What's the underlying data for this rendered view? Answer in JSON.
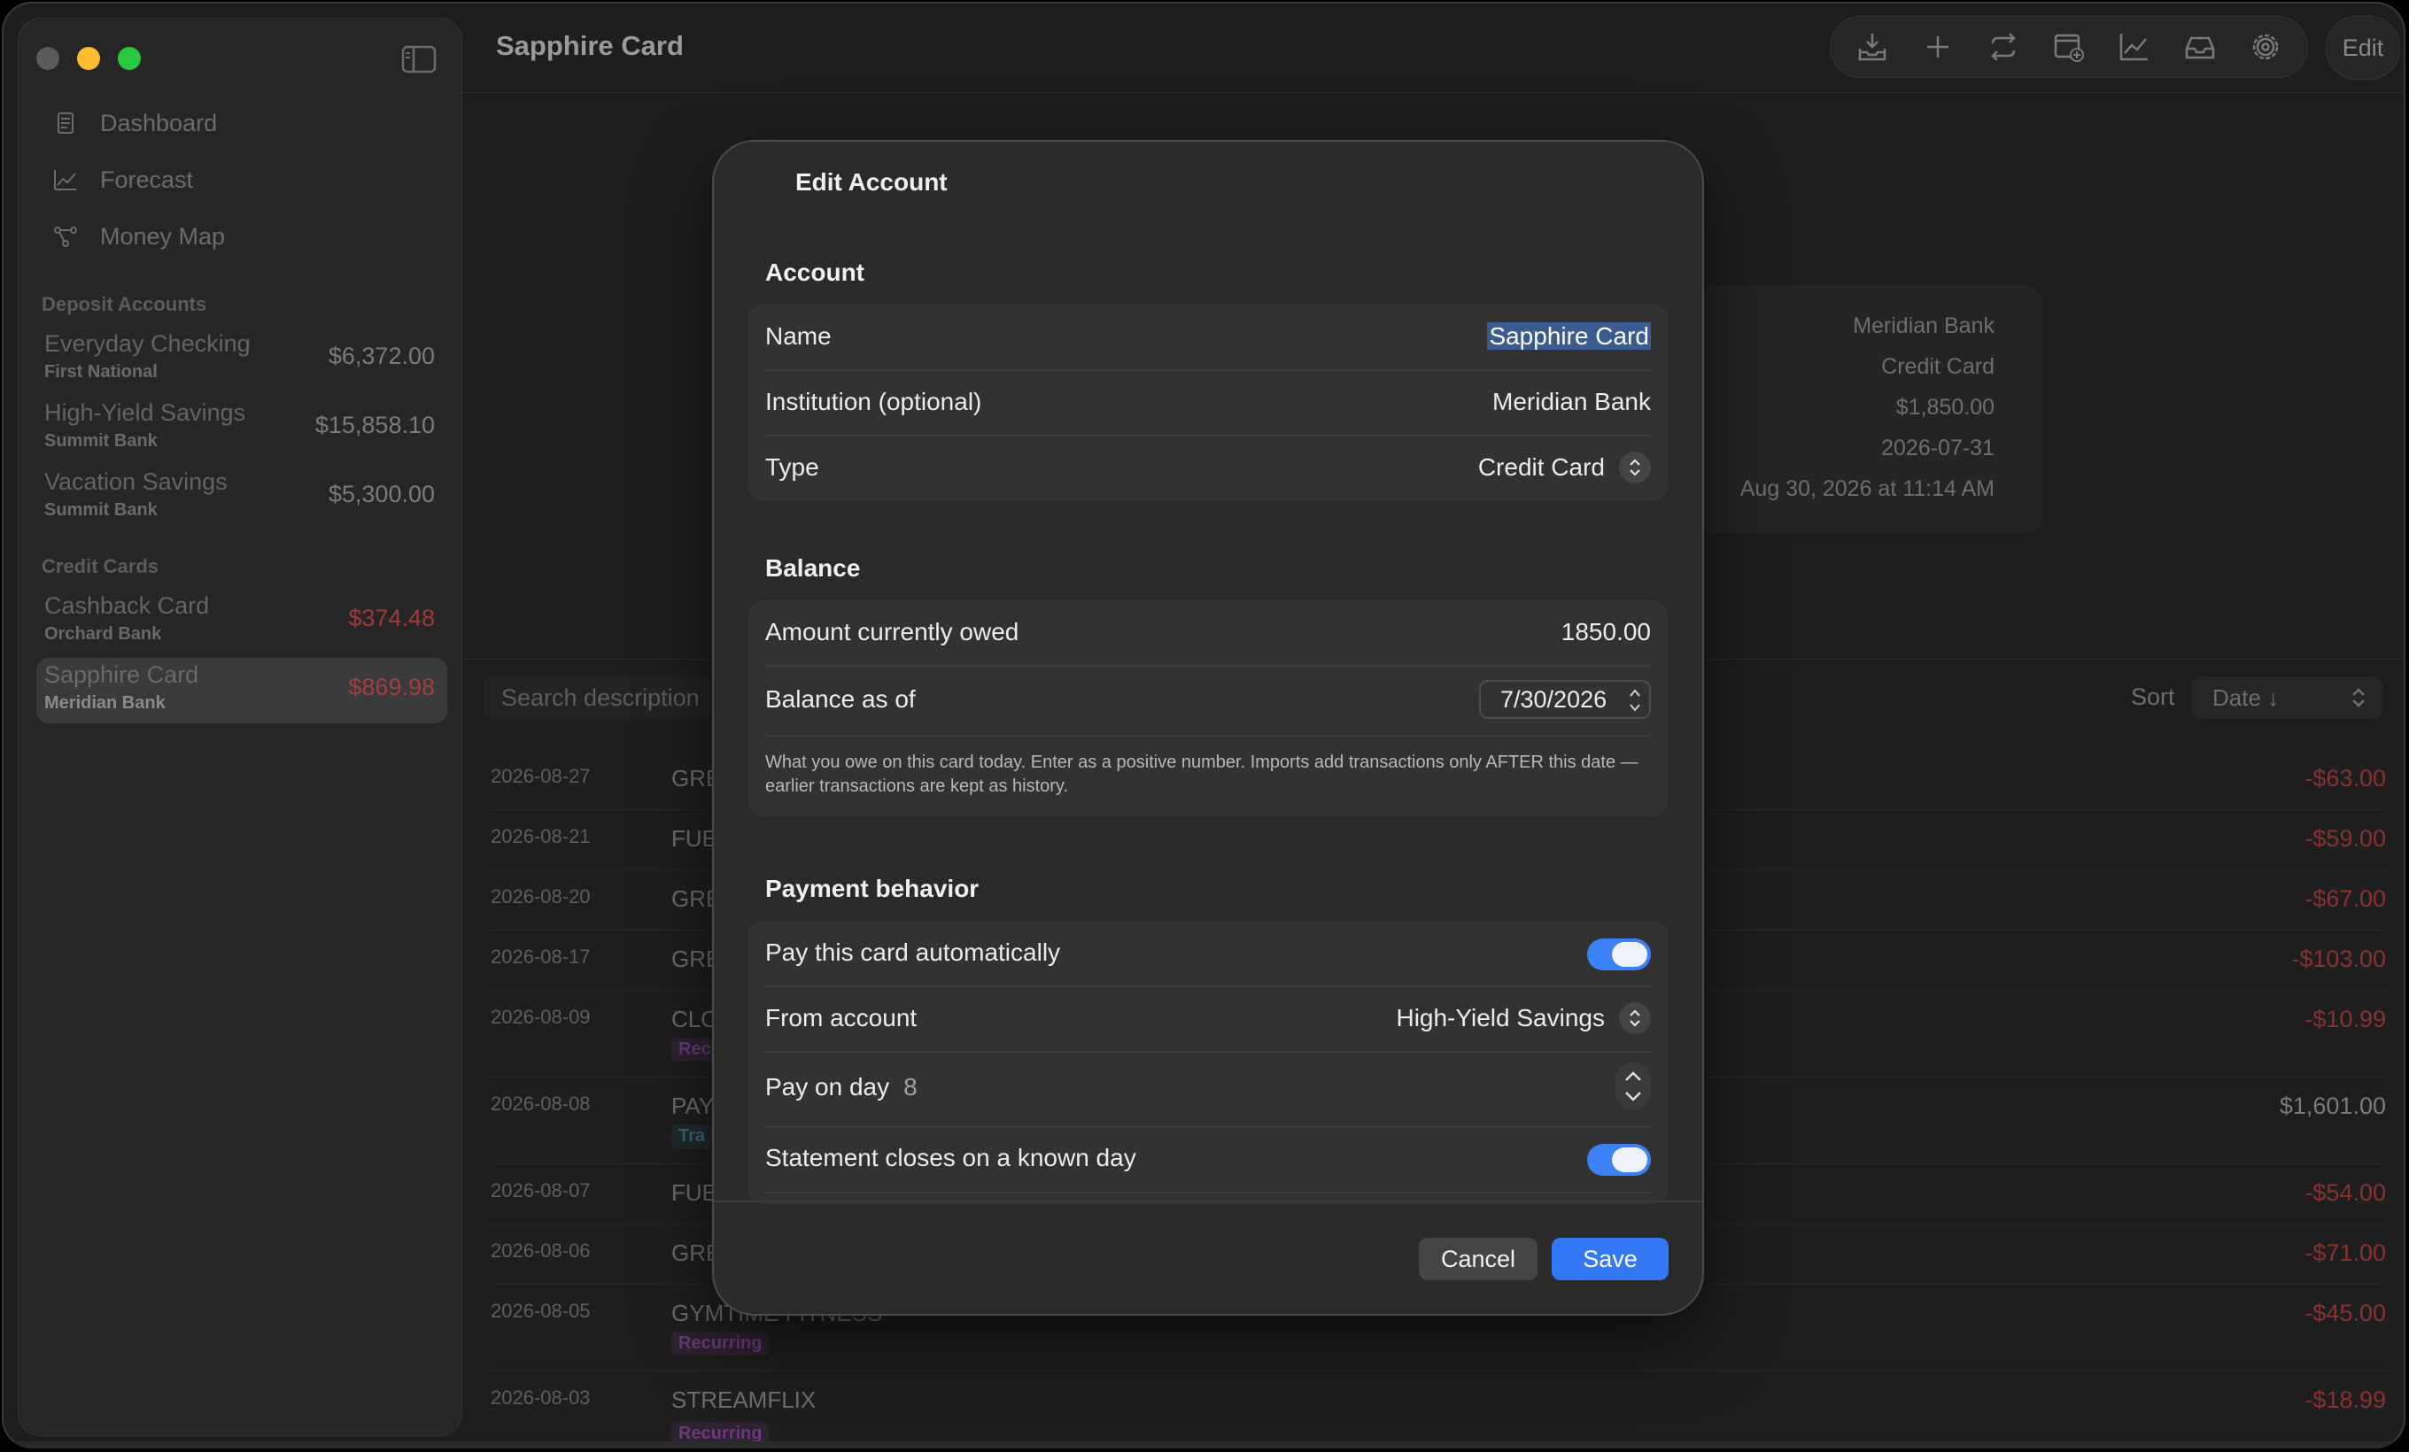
{
  "window": {
    "title": "Sapphire Card"
  },
  "sidebar": {
    "nav": [
      {
        "label": "Dashboard",
        "icon": "document-icon"
      },
      {
        "label": "Forecast",
        "icon": "chart-line-icon"
      },
      {
        "label": "Money Map",
        "icon": "graph-nodes-icon"
      }
    ],
    "deposit_label": "Deposit Accounts",
    "deposit_accounts": [
      {
        "name": "Everyday Checking",
        "institution": "First National",
        "balance": "$6,372.00"
      },
      {
        "name": "High-Yield Savings",
        "institution": "Summit Bank",
        "balance": "$15,858.10"
      },
      {
        "name": "Vacation Savings",
        "institution": "Summit Bank",
        "balance": "$5,300.00"
      }
    ],
    "credit_label": "Credit Cards",
    "credit_accounts": [
      {
        "name": "Cashback Card",
        "institution": "Orchard Bank",
        "balance": "$374.48"
      },
      {
        "name": "Sapphire Card",
        "institution": "Meridian Bank",
        "balance": "$869.98"
      }
    ]
  },
  "toolbar": {
    "icons": [
      "import-tray-icon",
      "plus-icon",
      "transfer-icon",
      "calendar-add-icon",
      "chart-icon",
      "inbox-icon",
      "gear-icon"
    ],
    "edit_label": "Edit"
  },
  "details": [
    "Meridian Bank",
    "Credit Card",
    "$1,850.00",
    "2026-07-31",
    "Aug 30, 2026 at 11:14 AM"
  ],
  "list": {
    "search_placeholder": "Search description",
    "sort_label": "Sort",
    "sort_value": "Date ↓",
    "transactions": [
      {
        "date": "2026-08-27",
        "desc": "GRE",
        "amount": "-$63.00"
      },
      {
        "date": "2026-08-21",
        "desc": "FUE",
        "amount": "-$59.00"
      },
      {
        "date": "2026-08-20",
        "desc": "GRE",
        "amount": "-$67.00"
      },
      {
        "date": "2026-08-17",
        "desc": "GRE",
        "amount": "-$103.00"
      },
      {
        "date": "2026-08-09",
        "desc": "CLO",
        "amount": "-$10.99",
        "tag": "Rec"
      },
      {
        "date": "2026-08-08",
        "desc": "PAY",
        "amount": "$1,601.00",
        "tag": "Tra"
      },
      {
        "date": "2026-08-07",
        "desc": "FUE",
        "amount": "-$54.00"
      },
      {
        "date": "2026-08-06",
        "desc": "GRE",
        "amount": "-$71.00"
      },
      {
        "date": "2026-08-05",
        "desc": "GYMTIME FITNESS",
        "amount": "-$45.00",
        "tag": "Recurring"
      },
      {
        "date": "2026-08-03",
        "desc": "STREAMFLIX",
        "amount": "-$18.99",
        "tag": "Recurring"
      }
    ]
  },
  "modal": {
    "title": "Edit Account",
    "account_section": "Account",
    "name_label": "Name",
    "name_value": "Sapphire Card",
    "institution_label": "Institution (optional)",
    "institution_value": "Meridian Bank",
    "type_label": "Type",
    "type_value": "Credit Card",
    "balance_section": "Balance",
    "owed_label": "Amount currently owed",
    "owed_value": "1850.00",
    "as_of_label": "Balance as of",
    "as_of_value": "7/30/2026",
    "balance_help": "What you owe on this card today. Enter as a positive number. Imports add transactions only AFTER this date — earlier transactions are kept as history.",
    "payment_section": "Payment behavior",
    "auto_pay_label": "Pay this card automatically",
    "auto_pay_on": true,
    "from_label": "From account",
    "from_value": "High-Yield Savings",
    "pay_day_label": "Pay on day",
    "pay_day_value": "8",
    "statement_label": "Statement closes on a known day",
    "statement_on": true,
    "cancel_label": "Cancel",
    "save_label": "Save"
  },
  "colors": {
    "accent": "#3478f6",
    "negative": "#8a3232",
    "selection": "#3a5b8e"
  }
}
